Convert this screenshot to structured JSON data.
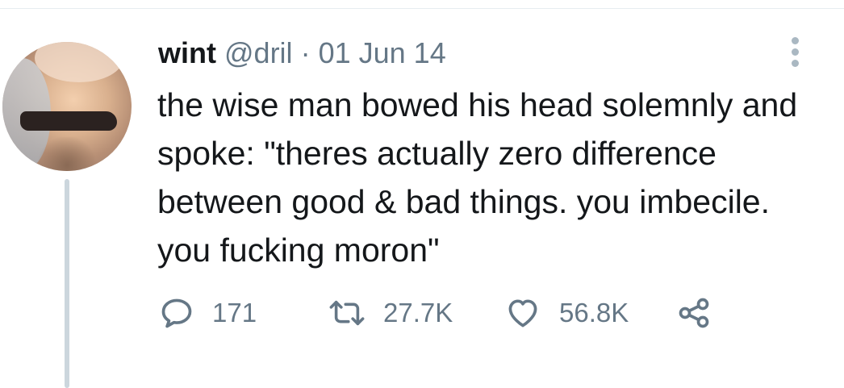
{
  "tweet": {
    "display_name": "wint",
    "handle": "@dril",
    "separator": "·",
    "date": "01 Jun 14",
    "text": "the wise man bowed his head solemnly and spoke: \"theres actually zero difference between good & bad things. you imbecile. you fucking moron\""
  },
  "actions": {
    "replies": "171",
    "retweets": "27.7K",
    "likes": "56.8K"
  },
  "colors": {
    "text": "#14171a",
    "secondary": "#657786",
    "thread_line": "#ccd6dd"
  },
  "icons": {
    "reply": "reply-icon",
    "retweet": "retweet-icon",
    "like": "heart-icon",
    "share": "share-icon",
    "more": "more-icon"
  }
}
